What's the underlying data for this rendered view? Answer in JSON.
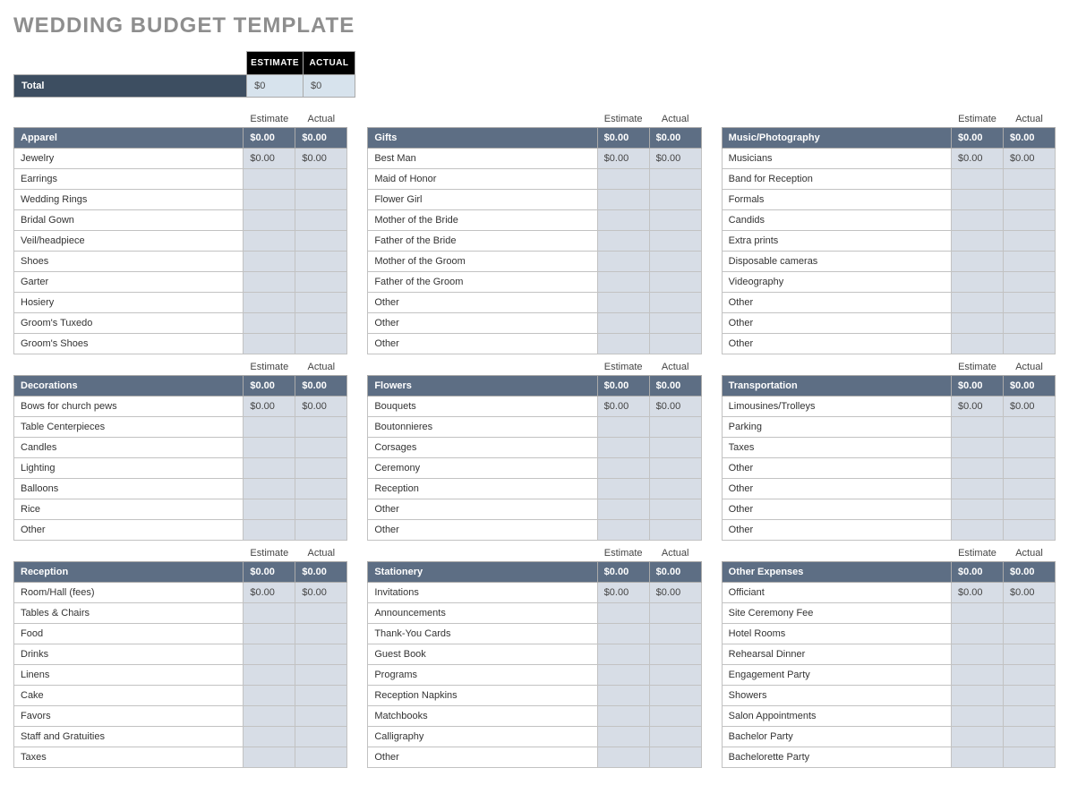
{
  "title": "WEDDING BUDGET TEMPLATE",
  "labels": {
    "estimate_header": "ESTIMATE",
    "actual_header": "ACTUAL",
    "estimate": "Estimate",
    "actual": "Actual"
  },
  "total": {
    "label": "Total",
    "estimate": "$0",
    "actual": "$0"
  },
  "columns": [
    [
      {
        "name": "Apparel",
        "estimate": "$0.00",
        "actual": "$0.00",
        "rows": [
          {
            "label": "Jewelry",
            "estimate": "$0.00",
            "actual": "$0.00"
          },
          {
            "label": "Earrings",
            "estimate": "",
            "actual": ""
          },
          {
            "label": "Wedding Rings",
            "estimate": "",
            "actual": ""
          },
          {
            "label": "Bridal Gown",
            "estimate": "",
            "actual": ""
          },
          {
            "label": "Veil/headpiece",
            "estimate": "",
            "actual": ""
          },
          {
            "label": "Shoes",
            "estimate": "",
            "actual": ""
          },
          {
            "label": "Garter",
            "estimate": "",
            "actual": ""
          },
          {
            "label": "Hosiery",
            "estimate": "",
            "actual": ""
          },
          {
            "label": "Groom's Tuxedo",
            "estimate": "",
            "actual": ""
          },
          {
            "label": "Groom's Shoes",
            "estimate": "",
            "actual": ""
          }
        ]
      },
      {
        "name": "Decorations",
        "estimate": "$0.00",
        "actual": "$0.00",
        "rows": [
          {
            "label": "Bows for church pews",
            "estimate": "$0.00",
            "actual": "$0.00"
          },
          {
            "label": "Table Centerpieces",
            "estimate": "",
            "actual": ""
          },
          {
            "label": "Candles",
            "estimate": "",
            "actual": ""
          },
          {
            "label": "Lighting",
            "estimate": "",
            "actual": ""
          },
          {
            "label": "Balloons",
            "estimate": "",
            "actual": ""
          },
          {
            "label": "Rice",
            "estimate": "",
            "actual": ""
          },
          {
            "label": "Other",
            "estimate": "",
            "actual": ""
          }
        ]
      },
      {
        "name": "Reception",
        "estimate": "$0.00",
        "actual": "$0.00",
        "rows": [
          {
            "label": "Room/Hall (fees)",
            "estimate": "$0.00",
            "actual": "$0.00"
          },
          {
            "label": "Tables & Chairs",
            "estimate": "",
            "actual": ""
          },
          {
            "label": "Food",
            "estimate": "",
            "actual": ""
          },
          {
            "label": "Drinks",
            "estimate": "",
            "actual": ""
          },
          {
            "label": "Linens",
            "estimate": "",
            "actual": ""
          },
          {
            "label": "Cake",
            "estimate": "",
            "actual": ""
          },
          {
            "label": "Favors",
            "estimate": "",
            "actual": ""
          },
          {
            "label": "Staff and Gratuities",
            "estimate": "",
            "actual": ""
          },
          {
            "label": "Taxes",
            "estimate": "",
            "actual": ""
          }
        ]
      }
    ],
    [
      {
        "name": "Gifts",
        "estimate": "$0.00",
        "actual": "$0.00",
        "rows": [
          {
            "label": "Best Man",
            "estimate": "$0.00",
            "actual": "$0.00"
          },
          {
            "label": "Maid of Honor",
            "estimate": "",
            "actual": ""
          },
          {
            "label": "Flower Girl",
            "estimate": "",
            "actual": ""
          },
          {
            "label": "Mother of the Bride",
            "estimate": "",
            "actual": ""
          },
          {
            "label": "Father of the Bride",
            "estimate": "",
            "actual": ""
          },
          {
            "label": "Mother of the Groom",
            "estimate": "",
            "actual": ""
          },
          {
            "label": "Father of the Groom",
            "estimate": "",
            "actual": ""
          },
          {
            "label": "Other",
            "estimate": "",
            "actual": ""
          },
          {
            "label": "Other",
            "estimate": "",
            "actual": ""
          },
          {
            "label": "Other",
            "estimate": "",
            "actual": ""
          }
        ]
      },
      {
        "name": "Flowers",
        "estimate": "$0.00",
        "actual": "$0.00",
        "rows": [
          {
            "label": "Bouquets",
            "estimate": "$0.00",
            "actual": "$0.00"
          },
          {
            "label": "Boutonnieres",
            "estimate": "",
            "actual": ""
          },
          {
            "label": "Corsages",
            "estimate": "",
            "actual": ""
          },
          {
            "label": "Ceremony",
            "estimate": "",
            "actual": ""
          },
          {
            "label": "Reception",
            "estimate": "",
            "actual": ""
          },
          {
            "label": "Other",
            "estimate": "",
            "actual": ""
          },
          {
            "label": "Other",
            "estimate": "",
            "actual": ""
          }
        ]
      },
      {
        "name": "Stationery",
        "estimate": "$0.00",
        "actual": "$0.00",
        "rows": [
          {
            "label": "Invitations",
            "estimate": "$0.00",
            "actual": "$0.00"
          },
          {
            "label": "Announcements",
            "estimate": "",
            "actual": ""
          },
          {
            "label": "Thank-You Cards",
            "estimate": "",
            "actual": ""
          },
          {
            "label": "Guest Book",
            "estimate": "",
            "actual": ""
          },
          {
            "label": "Programs",
            "estimate": "",
            "actual": ""
          },
          {
            "label": "Reception Napkins",
            "estimate": "",
            "actual": ""
          },
          {
            "label": "Matchbooks",
            "estimate": "",
            "actual": ""
          },
          {
            "label": "Calligraphy",
            "estimate": "",
            "actual": ""
          },
          {
            "label": "Other",
            "estimate": "",
            "actual": ""
          }
        ]
      }
    ],
    [
      {
        "name": "Music/Photography",
        "estimate": "$0.00",
        "actual": "$0.00",
        "rows": [
          {
            "label": "Musicians",
            "estimate": "$0.00",
            "actual": "$0.00"
          },
          {
            "label": "Band for Reception",
            "estimate": "",
            "actual": ""
          },
          {
            "label": "Formals",
            "estimate": "",
            "actual": ""
          },
          {
            "label": "Candids",
            "estimate": "",
            "actual": ""
          },
          {
            "label": "Extra prints",
            "estimate": "",
            "actual": ""
          },
          {
            "label": "Disposable cameras",
            "estimate": "",
            "actual": ""
          },
          {
            "label": "Videography",
            "estimate": "",
            "actual": ""
          },
          {
            "label": "Other",
            "estimate": "",
            "actual": ""
          },
          {
            "label": "Other",
            "estimate": "",
            "actual": ""
          },
          {
            "label": "Other",
            "estimate": "",
            "actual": ""
          }
        ]
      },
      {
        "name": "Transportation",
        "estimate": "$0.00",
        "actual": "$0.00",
        "rows": [
          {
            "label": "Limousines/Trolleys",
            "estimate": "$0.00",
            "actual": "$0.00"
          },
          {
            "label": "Parking",
            "estimate": "",
            "actual": ""
          },
          {
            "label": "Taxes",
            "estimate": "",
            "actual": ""
          },
          {
            "label": "Other",
            "estimate": "",
            "actual": ""
          },
          {
            "label": "Other",
            "estimate": "",
            "actual": ""
          },
          {
            "label": "Other",
            "estimate": "",
            "actual": ""
          },
          {
            "label": "Other",
            "estimate": "",
            "actual": ""
          }
        ]
      },
      {
        "name": "Other Expenses",
        "estimate": "$0.00",
        "actual": "$0.00",
        "rows": [
          {
            "label": "Officiant",
            "estimate": "$0.00",
            "actual": "$0.00"
          },
          {
            "label": "Site Ceremony Fee",
            "estimate": "",
            "actual": ""
          },
          {
            "label": "Hotel Rooms",
            "estimate": "",
            "actual": ""
          },
          {
            "label": "Rehearsal Dinner",
            "estimate": "",
            "actual": ""
          },
          {
            "label": "Engagement Party",
            "estimate": "",
            "actual": ""
          },
          {
            "label": "Showers",
            "estimate": "",
            "actual": ""
          },
          {
            "label": "Salon Appointments",
            "estimate": "",
            "actual": ""
          },
          {
            "label": "Bachelor Party",
            "estimate": "",
            "actual": ""
          },
          {
            "label": "Bachelorette Party",
            "estimate": "",
            "actual": ""
          }
        ]
      }
    ]
  ]
}
